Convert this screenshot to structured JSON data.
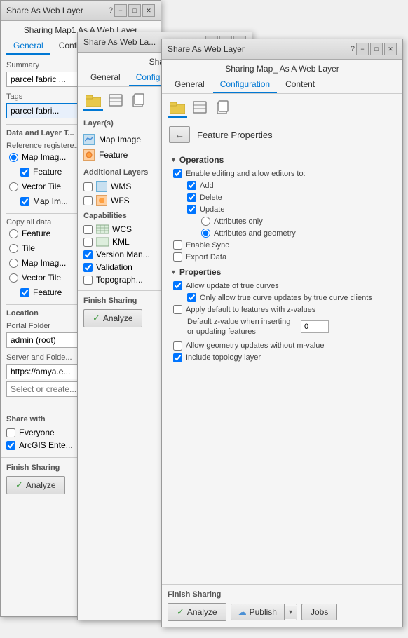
{
  "window1": {
    "title": "Share As Web Layer",
    "subtitle": "Sharing Map1 As A Web Layer",
    "tabs": [
      "General",
      "Configu..."
    ],
    "active_tab": "General",
    "summary_label": "Summary",
    "summary_value": "parcel fabric ...",
    "tags_label": "Tags",
    "tags_value": "parcel fabri...",
    "data_layer_label": "Data and Layer T...",
    "reference_label": "Reference registere...",
    "ref_options": [
      "Map Imag...",
      "Feature",
      "Vector Tile",
      "Map Im..."
    ],
    "copy_all_label": "Copy all data",
    "copy_options": [
      "Feature",
      "Tile",
      "Map Imag...",
      "Vector Tile"
    ],
    "feature_checked": true,
    "location_label": "Location",
    "portal_folder_label": "Portal Folder",
    "portal_folder_value": "admin (root)",
    "server_folder_label": "Server and Folde...",
    "server_url": "https://amya.e...",
    "select_placeholder": "Select or create...",
    "share_with_label": "Share with",
    "everyone_label": "Everyone",
    "arcgis_label": "ArcGIS Ente...",
    "arcgis_checked": true,
    "finish_label": "Finish Sharing",
    "analyze_label": "Analyze"
  },
  "window2": {
    "title": "Share As Web La...",
    "subtitle": "Sharin...",
    "tabs": [
      "General",
      "Configura..."
    ],
    "active_tab": "Configura...",
    "layers_label": "Layer(s)",
    "map_image_label": "Map Image",
    "feature_label": "Feature",
    "additional_layers_label": "Additional Layers",
    "wms_label": "WMS",
    "wfs_label": "WFS",
    "capabilities_label": "Capabilities",
    "wcs_label": "WCS",
    "kml_label": "KML",
    "version_label": "Version Man...",
    "version_checked": true,
    "validation_label": "Validation",
    "validation_checked": true,
    "topography_label": "Topograph...",
    "finish_label": "Finish Sharing",
    "analyze_label": "Analyze"
  },
  "window3": {
    "title": "Share As Web Layer",
    "subtitle": "Sharing Map_ As A Web Layer",
    "tabs": [
      "General",
      "Configuration",
      "Content"
    ],
    "active_tab": "Configuration",
    "back_label": "back",
    "feature_properties_title": "Feature Properties",
    "operations_label": "Operations",
    "enable_editing_label": "Enable editing and allow editors to:",
    "enable_editing_checked": true,
    "add_label": "Add",
    "add_checked": true,
    "delete_label": "Delete",
    "delete_checked": true,
    "update_label": "Update",
    "update_checked": true,
    "attributes_only_label": "Attributes only",
    "attributes_geometry_label": "Attributes and geometry",
    "attributes_geometry_checked": true,
    "enable_sync_label": "Enable Sync",
    "enable_sync_checked": false,
    "export_data_label": "Export Data",
    "export_data_checked": false,
    "properties_label": "Properties",
    "allow_true_curves_label": "Allow update of true curves",
    "allow_true_curves_checked": true,
    "only_true_curves_label": "Only allow true curve updates by true curve clients",
    "only_true_curves_checked": true,
    "apply_default_label": "Apply default to features with z-values",
    "apply_default_checked": false,
    "default_z_label": "Default z-value when inserting or updating features",
    "default_z_value": "0",
    "allow_geometry_label": "Allow geometry updates without m-value",
    "allow_geometry_checked": false,
    "include_topology_label": "Include topology layer",
    "include_topology_checked": true,
    "finish_label": "Finish Sharing",
    "analyze_label": "Analyze",
    "publish_label": "Publish",
    "jobs_label": "Jobs"
  },
  "icons": {
    "question": "?",
    "minimize": "−",
    "maximize": "□",
    "close": "✕",
    "back_arrow": "←",
    "collapse": "▼",
    "check": "✓",
    "cloud": "☁",
    "folder": "📁",
    "dropdown": "▾"
  }
}
